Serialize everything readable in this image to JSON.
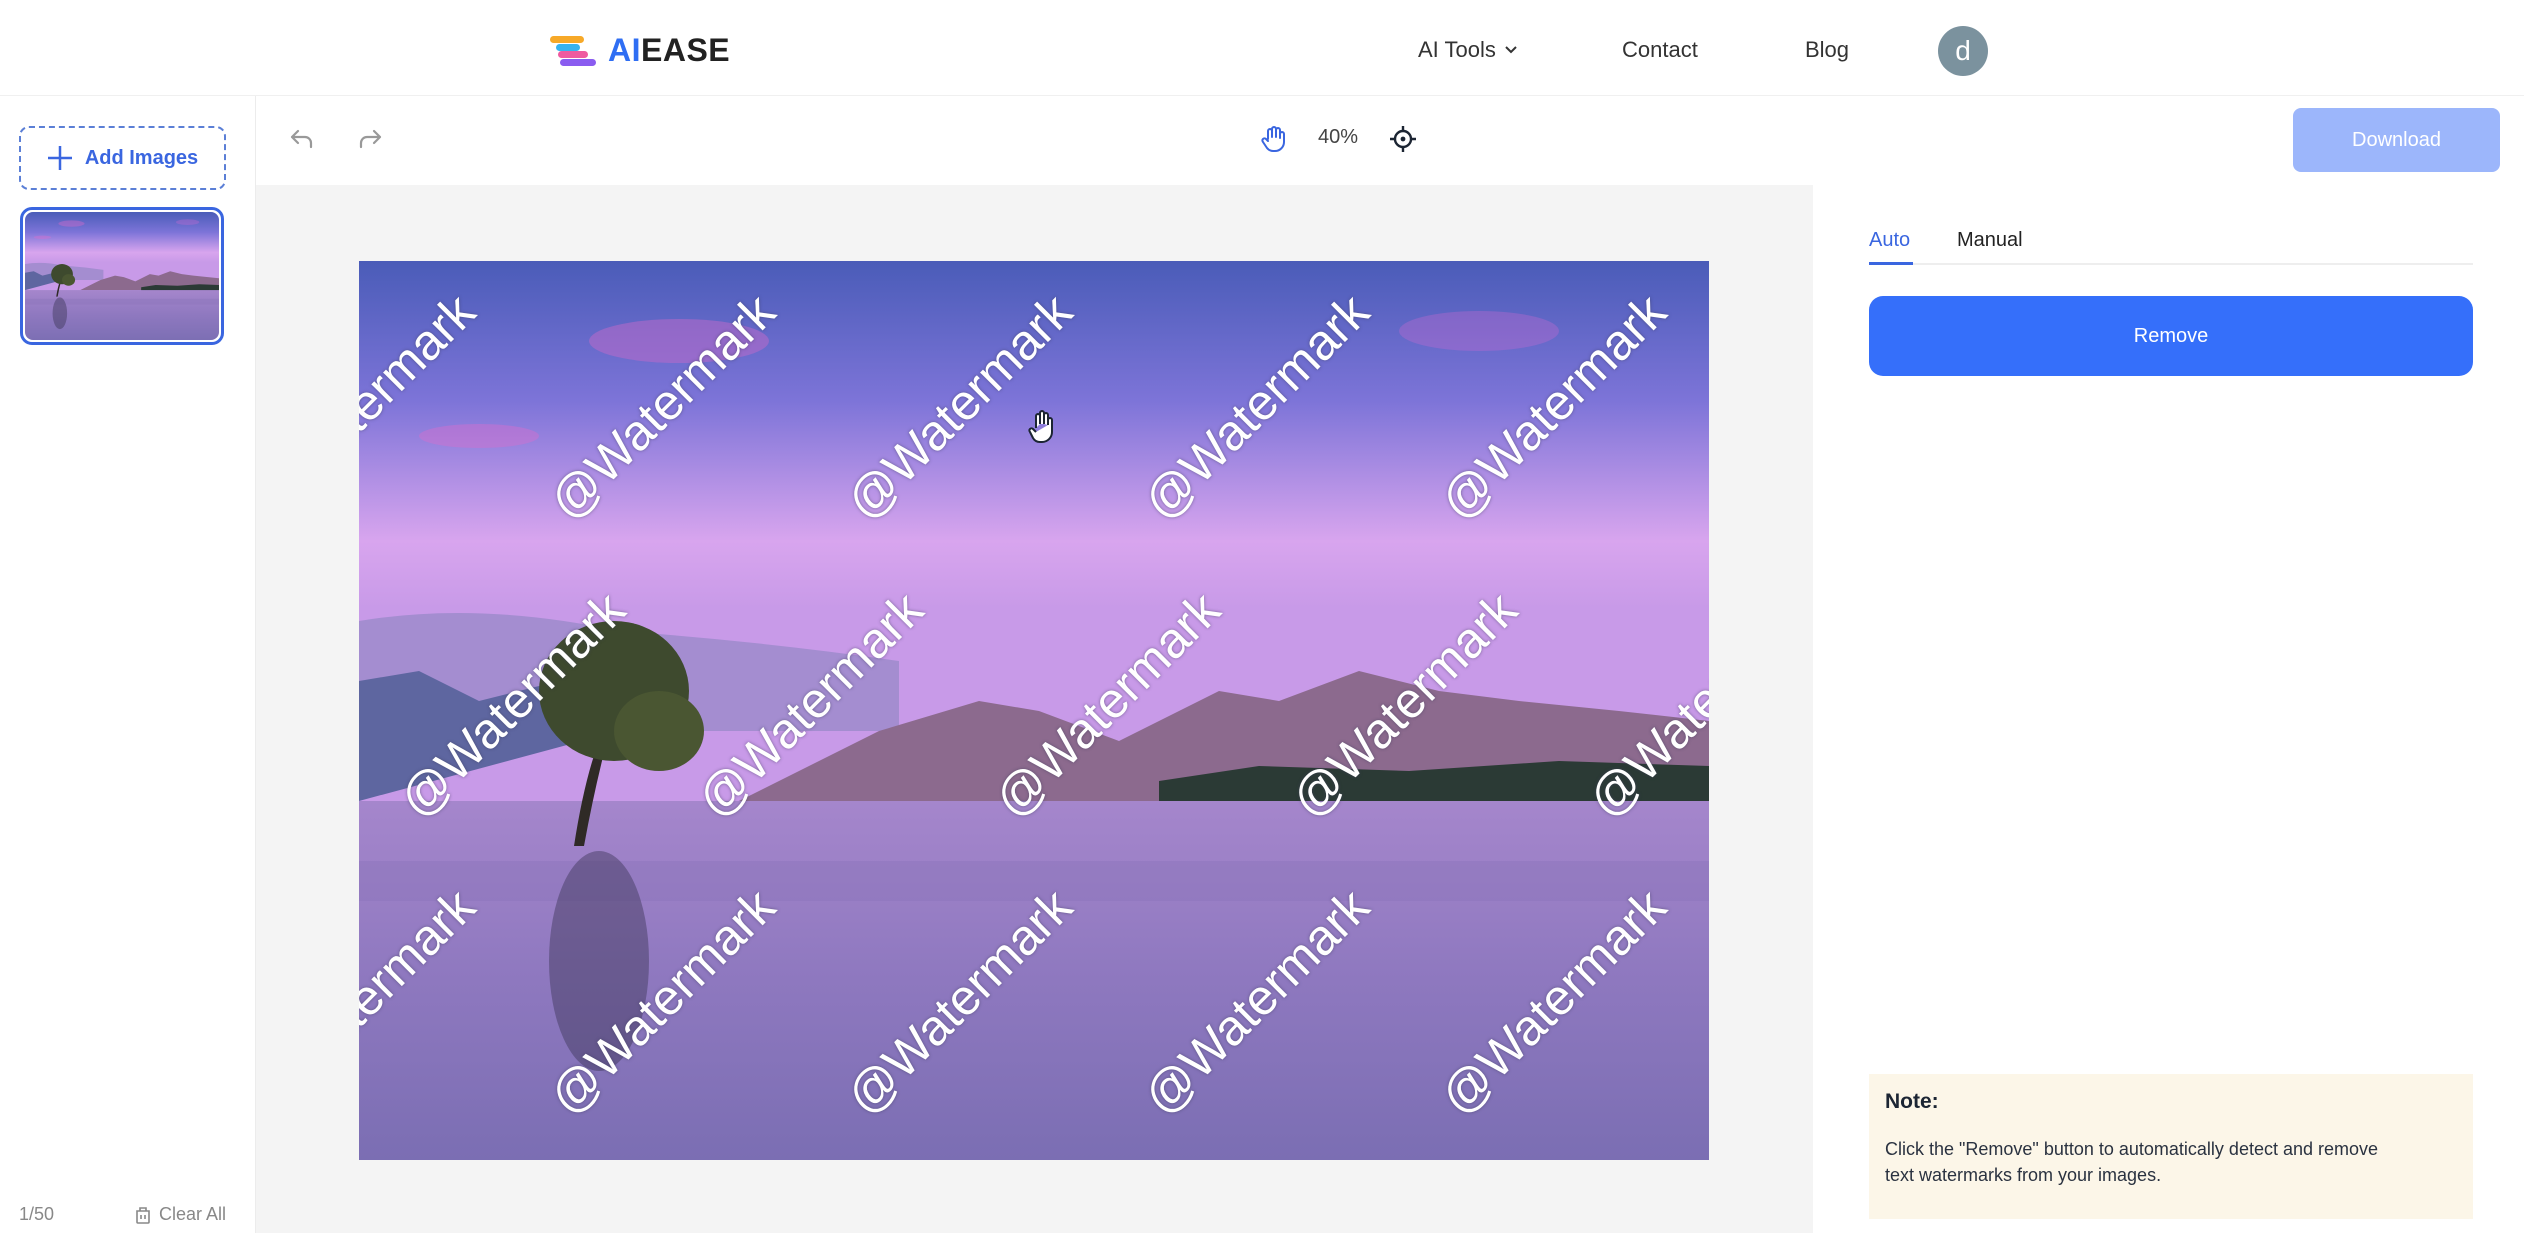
{
  "header": {
    "logo": {
      "ai": "AI",
      "ease": "EASE"
    },
    "nav": [
      {
        "label": "AI Tools",
        "has_dropdown": true
      },
      {
        "label": "Contact"
      },
      {
        "label": "Blog"
      }
    ],
    "avatar_initial": "d"
  },
  "sidebar": {
    "add_images_label": "Add Images",
    "thumbnail_alt": "Lake with lone tree at dusk, watermarked",
    "count": "1/50",
    "clear_all_label": "Clear All"
  },
  "toolbar": {
    "undo_icon": "undo-icon",
    "redo_icon": "redo-icon",
    "hand_icon": "hand-icon",
    "zoom_level": "40%",
    "recenter_icon": "crosshair-icon",
    "download_label": "Download",
    "download_enabled": false
  },
  "canvas": {
    "watermark_text": "@Watermark",
    "image_description": "Purple-sky lake scene with a lone tree and mountains"
  },
  "panel": {
    "tabs": [
      {
        "label": "Auto",
        "active": true
      },
      {
        "label": "Manual",
        "active": false
      }
    ],
    "remove_label": "Remove",
    "note_title": "Note:",
    "note_text": "Click the \"Remove\" button to automatically detect and remove text watermarks  from your images."
  },
  "colors": {
    "accent": "#356ffa",
    "accent_text": "#3a66e0",
    "download_disabled": "#9cb6fb",
    "note_bg": "#fcf6e8",
    "avatar_bg": "#7b929e"
  }
}
